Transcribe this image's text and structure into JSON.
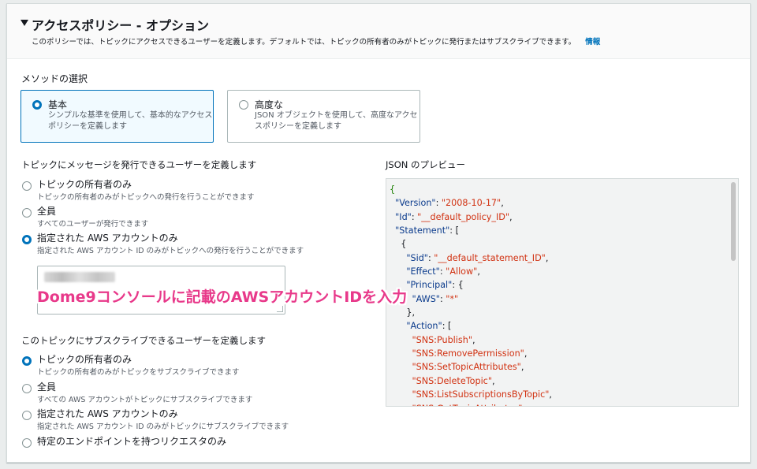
{
  "section": {
    "title": "アクセスポリシー - オプション",
    "description": "このポリシーでは、トピックにアクセスできるユーザーを定義します。デフォルトでは、トピックの所有者のみがトピックに発行またはサブスクライブできます。",
    "info_link": "情報"
  },
  "method": {
    "label": "メソッドの選択",
    "options": [
      {
        "title": "基本",
        "description": "シンプルな基準を使用して、基本的なアクセスポリシーを定義します",
        "selected": true
      },
      {
        "title": "高度な",
        "description": "JSON オブジェクトを使用して、高度なアクセスポリシーを定義します",
        "selected": false
      }
    ]
  },
  "publish": {
    "label": "トピックにメッセージを発行できるユーザーを定義します",
    "options": [
      {
        "title": "トピックの所有者のみ",
        "description": "トピックの所有者のみがトピックへの発行を行うことができます",
        "selected": false
      },
      {
        "title": "全員",
        "description": "すべてのユーザーが発行できます",
        "selected": false
      },
      {
        "title": "指定された AWS アカウントのみ",
        "description": "指定された AWS アカウント ID のみがトピックへの発行を行うことができます",
        "selected": true
      }
    ]
  },
  "subscribe": {
    "label": "このトピックにサブスクライブできるユーザーを定義します",
    "options": [
      {
        "title": "トピックの所有者のみ",
        "description": "トピックの所有者のみがトピックをサブスクライブできます",
        "selected": true
      },
      {
        "title": "全員",
        "description": "すべての AWS アカウントがトピックにサブスクライブできます",
        "selected": false
      },
      {
        "title": "指定された AWS アカウントのみ",
        "description": "指定された AWS アカウント ID のみがトピックにサブスクライブできます",
        "selected": false
      },
      {
        "title": "特定のエンドポイントを持つリクエスタのみ",
        "description": "",
        "selected": false
      }
    ]
  },
  "json_preview": {
    "label": "JSON のプレビュー",
    "lines": [
      "{",
      "  \"Version\": \"2008-10-17\",",
      "  \"Id\": \"__default_policy_ID\",",
      "  \"Statement\": [",
      "    {",
      "      \"Sid\": \"__default_statement_ID\",",
      "      \"Effect\": \"Allow\",",
      "      \"Principal\": {",
      "        \"AWS\": \"*\"",
      "      },",
      "      \"Action\": [",
      "        \"SNS:Publish\",",
      "        \"SNS:RemovePermission\",",
      "        \"SNS:SetTopicAttributes\",",
      "        \"SNS:DeleteTopic\",",
      "        \"SNS:ListSubscriptionsByTopic\",",
      "        \"SNS:GetTopicAttributes\","
    ]
  },
  "annotation": {
    "text": "Dome9コンソールに記載のAWSアカウントIDを入力",
    "color": "#e8398a"
  },
  "colors": {
    "accent": "#0073bb",
    "json_string": "#d13212"
  }
}
